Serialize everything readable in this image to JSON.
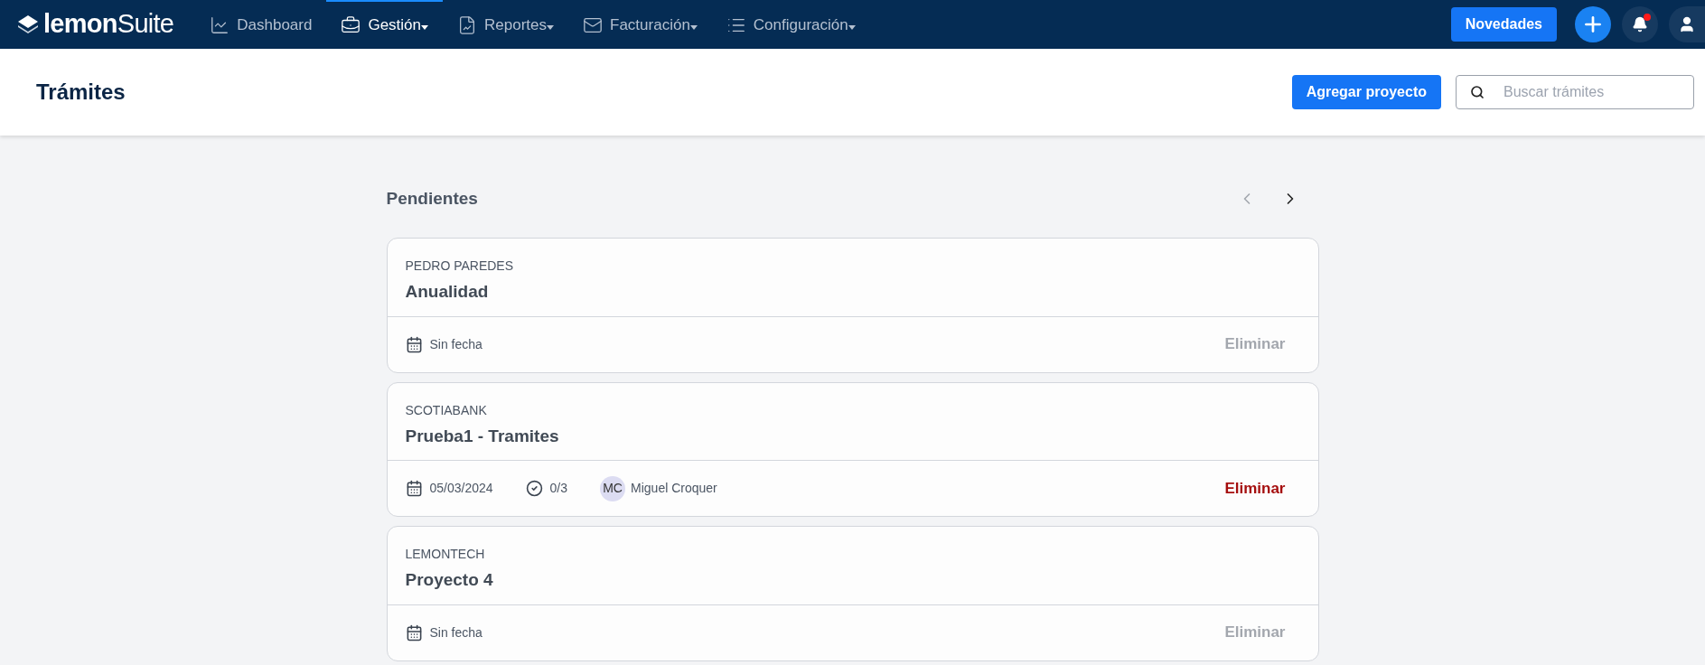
{
  "navbar": {
    "logo": "**lemon**Suite",
    "items": [
      {
        "label": "Dashboard",
        "dropdown": false,
        "selected": false
      },
      {
        "label": "Gestión",
        "dropdown": true,
        "selected": true
      },
      {
        "label": "Reportes",
        "dropdown": true,
        "selected": false
      },
      {
        "label": "Facturación",
        "dropdown": true,
        "selected": false
      },
      {
        "label": "Configuración",
        "dropdown": true,
        "selected": false
      }
    ],
    "news_button": "Novedades",
    "notifications": {
      "unread": true
    }
  },
  "header": {
    "title": "Trámites",
    "add_button": "Agregar proyecto",
    "search": {
      "placeholder": "Buscar trámites"
    }
  },
  "section": {
    "title": "Pendientes",
    "prev": {
      "disabled": true
    },
    "next": {
      "disabled": false
    },
    "cards": [
      {
        "client": "PEDRO PAREDES",
        "title": "Anualidad",
        "date": "Sin fecha",
        "delete": "Eliminar",
        "delete_enabled": false
      },
      {
        "client": "SCOTIABANK",
        "title": "Prueba1 - Tramites",
        "date": "05/03/2024",
        "tasks": "0/3",
        "assignee": {
          "initials": "MC",
          "name": "Miguel Croquer"
        },
        "delete": "Eliminar",
        "delete_enabled": true
      },
      {
        "client": "LEMONTECH",
        "title": "Proyecto 4",
        "date": "Sin fecha",
        "delete": "Eliminar",
        "delete_enabled": false
      }
    ]
  }
}
